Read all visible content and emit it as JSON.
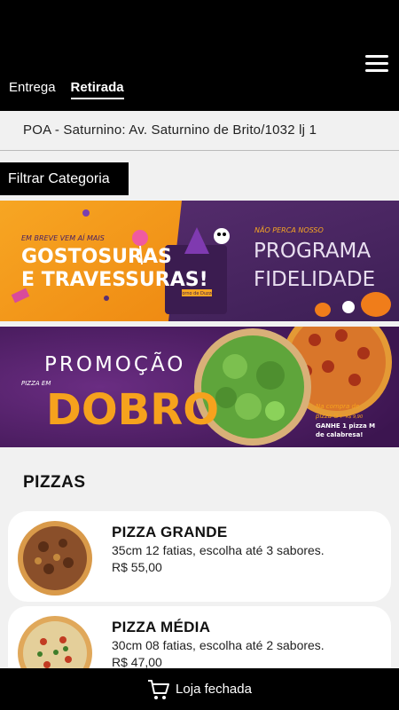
{
  "header": {
    "menu_icon": "hamburger-menu-icon",
    "tabs": [
      {
        "label": "Entrega",
        "active": false
      },
      {
        "label": "Retirada",
        "active": true
      }
    ]
  },
  "store": {
    "address": "POA - Saturnino: Av. Saturnino de Brito/1032 lj 1"
  },
  "filter": {
    "label": "Filtrar Categoria"
  },
  "banners": {
    "first": {
      "left_small": "EM BREVE VEM AÍ MAIS",
      "left_big_1": "GOSTOSURAS",
      "left_big_2": "E TRAVESSURAS!",
      "bag_label": "Forno de Duzzo",
      "right_small": "NÃO PERCA NOSSO",
      "right_big_1": "PROGRAMA",
      "right_big_2": "FIDELIDADE",
      "colors": {
        "left": "#f39a1c",
        "right": "#4b2763"
      }
    },
    "second": {
      "title": "PROMOÇÃO",
      "pizza_em": "PIZZA EM",
      "big": "DOBRO",
      "note_1": "Na compra de",
      "note_2": "pizza G+",
      "note_price": "R$ 9,90",
      "note_3": "GANHE 1 pizza M",
      "note_4": "de calabresa!",
      "colors": {
        "background": "#4a1e5e",
        "accent": "#f6a21d"
      }
    }
  },
  "section": {
    "title": "PIZZAS"
  },
  "products": [
    {
      "name": "PIZZA GRANDE",
      "description": "35cm 12 fatias, escolha até 3 sabores.",
      "price": "R$ 55,00"
    },
    {
      "name": "PIZZA MÉDIA",
      "description": "30cm 08 fatias, escolha até 2 sabores.",
      "price": "R$ 47,00"
    }
  ],
  "footer": {
    "cart_icon": "cart-icon",
    "status": "Loja fechada"
  }
}
